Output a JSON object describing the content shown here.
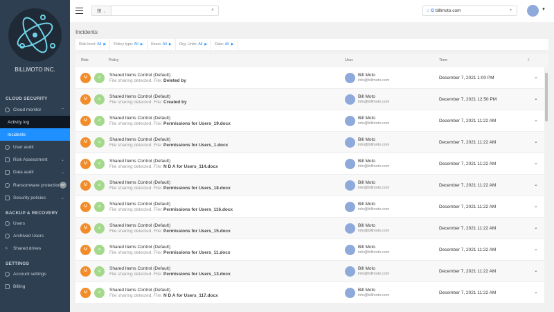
{
  "sidebar": {
    "company": "BILLMOTO INC.",
    "sections": [
      "CLOUD SECURITY",
      "BACKUP & RECOVERY",
      "SETTINGS"
    ],
    "items": [
      {
        "label": "Cloud monitor"
      },
      {
        "label": "Activity log"
      },
      {
        "label": "Incidents"
      },
      {
        "label": "User audit"
      },
      {
        "label": "Risk Assessment"
      },
      {
        "label": "Data audit"
      },
      {
        "label": "Ransomware protection"
      },
      {
        "label": "Security policies"
      },
      {
        "label": "Users"
      },
      {
        "label": "Archived Users"
      },
      {
        "label": "Shared drives"
      },
      {
        "label": "Account settings"
      },
      {
        "label": "Billing"
      }
    ],
    "badge": "99+"
  },
  "topbar": {
    "search_placeholder": "",
    "domain": "billmoto.com"
  },
  "page": {
    "title": "Incidents"
  },
  "filters": [
    {
      "label": "Risk level:",
      "value": "All"
    },
    {
      "label": "Policy type:",
      "value": "All"
    },
    {
      "label": "Users:",
      "value": "All"
    },
    {
      "label": "Org. Units:",
      "value": "All"
    },
    {
      "label": "Date:",
      "value": "All"
    }
  ],
  "columns": {
    "risk": "Risk",
    "policy": "Policy",
    "user": "User",
    "time": "Time"
  },
  "rows": [
    {
      "risk": "M",
      "policy": "Shared Items Control (Default)",
      "desc": "File sharing detected. File:",
      "file": "Deleted by",
      "user": "Bill Moto",
      "email": "info@billmoto.com",
      "time": "December 7, 2021 1:00 PM"
    },
    {
      "risk": "M",
      "policy": "Shared Items Control (Default)",
      "desc": "File sharing detected. File:",
      "file": "Created by",
      "user": "Bill Moto",
      "email": "info@billmoto.com",
      "time": "December 7, 2021 12:50 PM"
    },
    {
      "risk": "M",
      "policy": "Shared Items Control (Default)",
      "desc": "File sharing detected. File:",
      "file": "Permissions for Users_19.docx",
      "user": "Bill Moto",
      "email": "info@billmoto.com",
      "time": "December 7, 2021 11:22 AM"
    },
    {
      "risk": "M",
      "policy": "Shared Items Control (Default)",
      "desc": "File sharing detected. File:",
      "file": "Permissions for Users_1.docx",
      "user": "Bill Moto",
      "email": "info@billmoto.com",
      "time": "December 7, 2021 11:22 AM"
    },
    {
      "risk": "M",
      "policy": "Shared Items Control (Default)",
      "desc": "File sharing detected. File:",
      "file": "N D A for Users_114.docx",
      "user": "Bill Moto",
      "email": "info@billmoto.com",
      "time": "December 7, 2021 11:22 AM"
    },
    {
      "risk": "M",
      "policy": "Shared Items Control (Default)",
      "desc": "File sharing detected. File:",
      "file": "Permissions for Users_18.docx",
      "user": "Bill Moto",
      "email": "info@billmoto.com",
      "time": "December 7, 2021 11:22 AM"
    },
    {
      "risk": "M",
      "policy": "Shared Items Control (Default)",
      "desc": "File sharing detected. File:",
      "file": "Permissions for Users_116.docx",
      "user": "Bill Moto",
      "email": "info@billmoto.com",
      "time": "December 7, 2021 11:22 AM"
    },
    {
      "risk": "M",
      "policy": "Shared Items Control (Default)",
      "desc": "File sharing detected. File:",
      "file": "Permissions for Users_15.docx",
      "user": "Bill Moto",
      "email": "info@billmoto.com",
      "time": "December 7, 2021 11:22 AM"
    },
    {
      "risk": "M",
      "policy": "Shared Items Control (Default)",
      "desc": "File sharing detected. File:",
      "file": "Permissions for Users_11.docx",
      "user": "Bill Moto",
      "email": "info@billmoto.com",
      "time": "December 7, 2021 11:22 AM"
    },
    {
      "risk": "M",
      "policy": "Shared Items Control (Default)",
      "desc": "File sharing detected. File:",
      "file": "Permissions for Users_13.docx",
      "user": "Bill Moto",
      "email": "info@billmoto.com",
      "time": "December 7, 2021 11:22 AM"
    },
    {
      "risk": "M",
      "policy": "Shared Items Control (Default)",
      "desc": "File sharing detected. File:",
      "file": "N D A for Users_117.docx",
      "user": "Bill Moto",
      "email": "info@billmoto.com",
      "time": "December 7, 2021 11:22 AM"
    }
  ],
  "colors": {
    "sidebar": "#2e3f51",
    "active": "#1e90ff",
    "risk_medium": "#f28c28",
    "share": "#a4d88b"
  }
}
